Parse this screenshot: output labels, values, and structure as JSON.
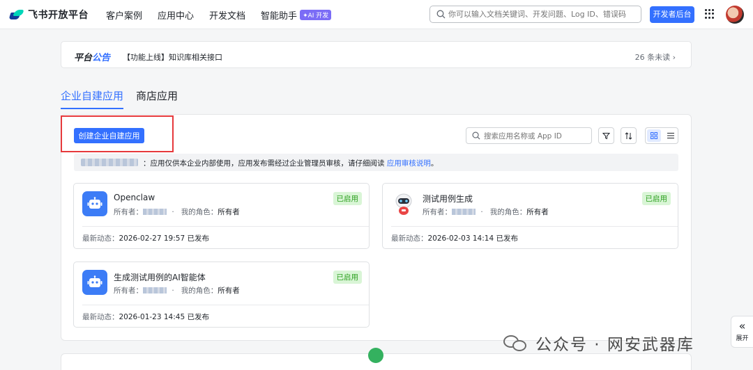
{
  "header": {
    "logo_text": "飞书开放平台",
    "nav": [
      "客户案例",
      "应用中心",
      "开发文档",
      "智能助手"
    ],
    "ai_badge": "✦AI 开发",
    "search_placeholder": "你可以输入文档关键词、开发问题、Log ID、错误码",
    "dev_console": "开发者后台"
  },
  "notice": {
    "tag_prefix": "平台",
    "tag_highlight": "公告",
    "message": "【功能上线】知识库相关接口",
    "unread": "26 条未读 ›"
  },
  "tabs": [
    "企业自建应用",
    "商店应用"
  ],
  "toolbar": {
    "create_label": "创建企业自建应用",
    "search_placeholder": "搜索应用名称或 App ID"
  },
  "info": {
    "text": "：应用仅供本企业内部使用，应用发布需经过企业管理员审核，请仔细阅读 ",
    "link": "应用审核说明",
    "suffix": "。"
  },
  "labels": {
    "owner": "所有者：",
    "role": "我的角色：",
    "activity": "最新动态："
  },
  "apps": [
    {
      "name": "Openclaw",
      "status": "已启用",
      "role": "所有者",
      "activity": "2026-02-27 19:57 已发布",
      "icon": "robot-bot-icon"
    },
    {
      "name": "测试用例生成",
      "status": "已启用",
      "role": "所有者",
      "activity": "2026-02-03 14:14 已发布",
      "icon": "robot-mascot-icon"
    },
    {
      "name": "生成测试用例的AI智能体",
      "status": "已启用",
      "role": "所有者",
      "activity": "2026-01-23 14:45 已发布",
      "icon": "robot-bot-icon"
    }
  ],
  "side": {
    "chevron": "«",
    "label": "展开"
  },
  "brand_watermark": "公众号 · 网安武器库",
  "colors": {
    "primary": "#3370ff",
    "success": "#2ea121",
    "highlight_border": "#e6393c"
  }
}
